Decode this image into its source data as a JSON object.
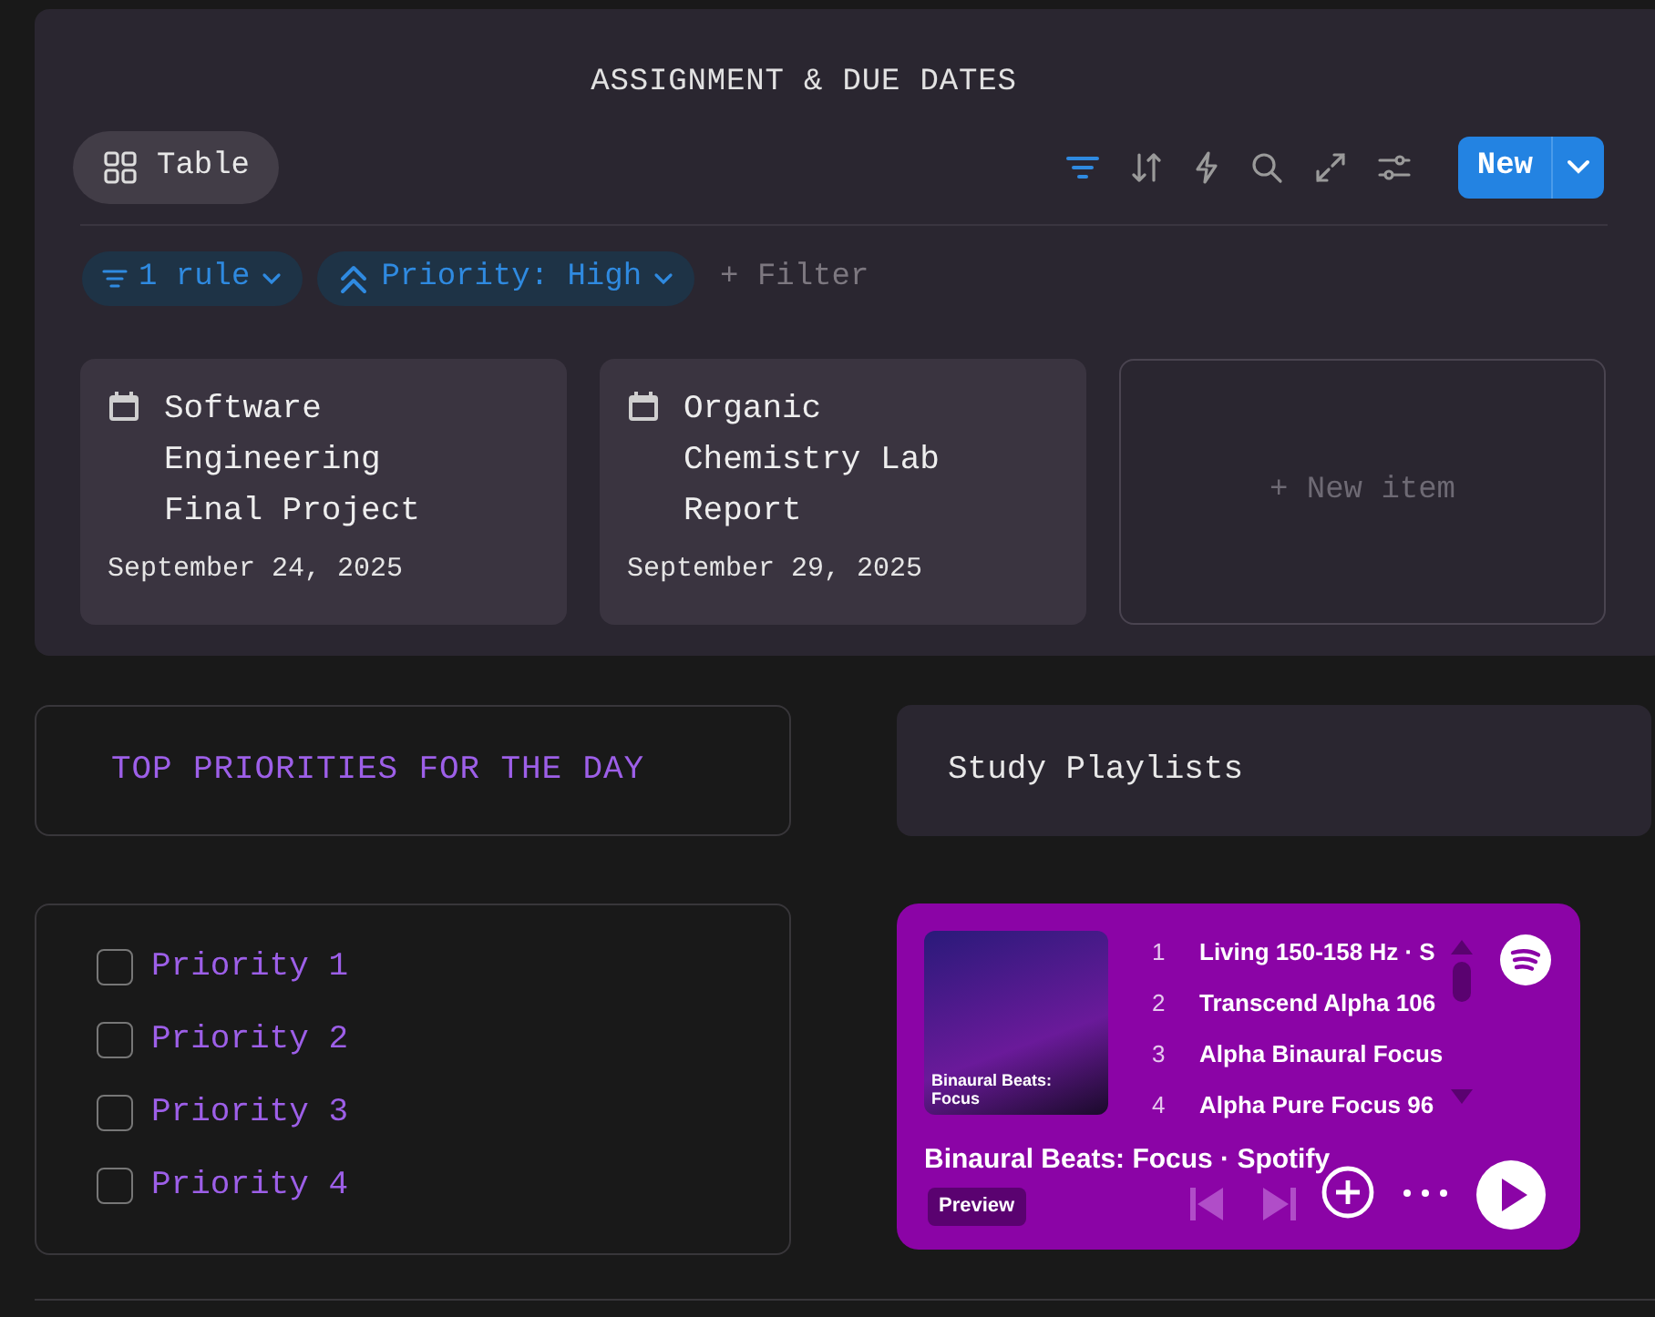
{
  "board": {
    "title": "ASSIGNMENT & DUE DATES",
    "view_tab": {
      "label": "Table",
      "selected": true
    },
    "toolbar": [
      {
        "kind": "filter",
        "active": true
      },
      {
        "kind": "sort",
        "active": false
      },
      {
        "kind": "bolt",
        "active": false
      },
      {
        "kind": "search",
        "active": false
      },
      {
        "kind": "expand",
        "active": false
      },
      {
        "kind": "settings",
        "active": false
      }
    ],
    "new_button": "New",
    "filters": [
      {
        "kind": "rule",
        "label": "1 rule"
      },
      {
        "kind": "priority",
        "label": "Priority: High"
      }
    ],
    "add_filter": "+ Filter",
    "cards": [
      {
        "title": "Software Engineering Final Project",
        "date": "September 24, 2025"
      },
      {
        "title": "Organic Chemistry Lab Report",
        "date": "September 29, 2025"
      }
    ],
    "new_item": "+ New item"
  },
  "priorities": {
    "heading": "TOP PRIORITIES FOR THE DAY",
    "items": [
      {
        "label": "Priority 1",
        "checked": false
      },
      {
        "label": "Priority 2",
        "checked": false
      },
      {
        "label": "Priority 3",
        "checked": false
      },
      {
        "label": "Priority 4",
        "checked": false
      }
    ]
  },
  "playlists": {
    "heading": "Study Playlists",
    "player": {
      "cover_caption": "Binaural Beats: Focus",
      "tracks": [
        {
          "number": "1",
          "title": "Living 150-158 Hz · S"
        },
        {
          "number": "2",
          "title": "Transcend Alpha 106"
        },
        {
          "number": "3",
          "title": "Alpha Binaural Focus"
        },
        {
          "number": "4",
          "title": "Alpha Pure Focus 96"
        }
      ],
      "title": "Binaural Beats: Focus · Spotify",
      "badge": "Preview"
    }
  }
}
